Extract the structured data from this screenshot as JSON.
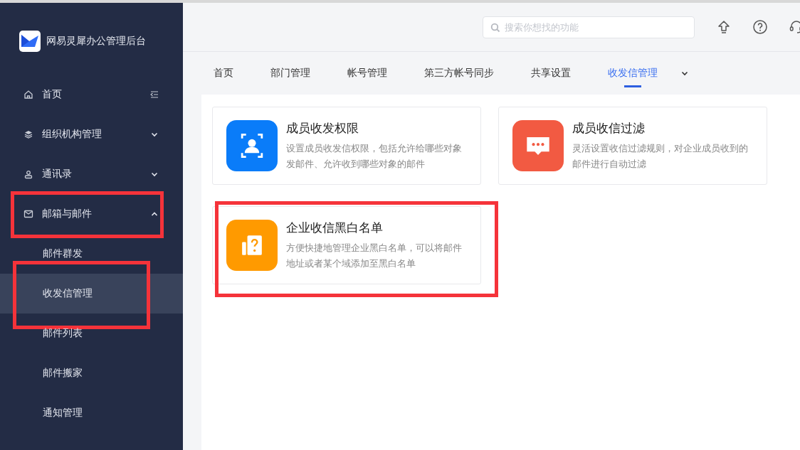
{
  "brand": {
    "name": "网易灵犀办公管理后台"
  },
  "sidebar": {
    "items": [
      {
        "label": "首页",
        "kind": "link",
        "expanded": false,
        "annotated": false
      },
      {
        "label": "组织机构管理",
        "kind": "group",
        "expanded": false,
        "annotated": false
      },
      {
        "label": "通讯录",
        "kind": "group",
        "expanded": false,
        "annotated": false
      },
      {
        "label": "邮箱与邮件",
        "kind": "group",
        "expanded": true,
        "annotated": true,
        "children": [
          {
            "label": "邮件群发",
            "selected": false,
            "annotated": false
          },
          {
            "label": "收发信管理",
            "selected": true,
            "annotated": true
          },
          {
            "label": "邮件列表",
            "selected": false,
            "annotated": false
          },
          {
            "label": "邮件搬家",
            "selected": false,
            "annotated": false
          },
          {
            "label": "通知管理",
            "selected": false,
            "annotated": false
          }
        ]
      }
    ]
  },
  "search": {
    "placeholder": "搜索你想找的功能"
  },
  "tabs": [
    {
      "label": "首页",
      "selected": false
    },
    {
      "label": "部门管理",
      "selected": false
    },
    {
      "label": "帐号管理",
      "selected": false
    },
    {
      "label": "第三方帐号同步",
      "selected": false
    },
    {
      "label": "共享设置",
      "selected": false
    },
    {
      "label": "收发信管理",
      "selected": true
    }
  ],
  "cards": [
    {
      "title": "成员收发权限",
      "description": "设置成员收发信权限，包括允许给哪些对象发邮件、允许收到哪些对象的邮件",
      "color": "#0a7cf9",
      "annotated": false
    },
    {
      "title": "成员收信过滤",
      "description": "灵活设置收信过滤规则，对企业成员收到的邮件进行自动过滤",
      "color": "#f25a42",
      "annotated": false
    },
    {
      "title": "企业收信黑白名单",
      "description": "方便快捷地管理企业黑白名单，可以将邮件地址或者某个域添加至黑白名单",
      "color": "#ff9a00",
      "annotated": true
    }
  ]
}
